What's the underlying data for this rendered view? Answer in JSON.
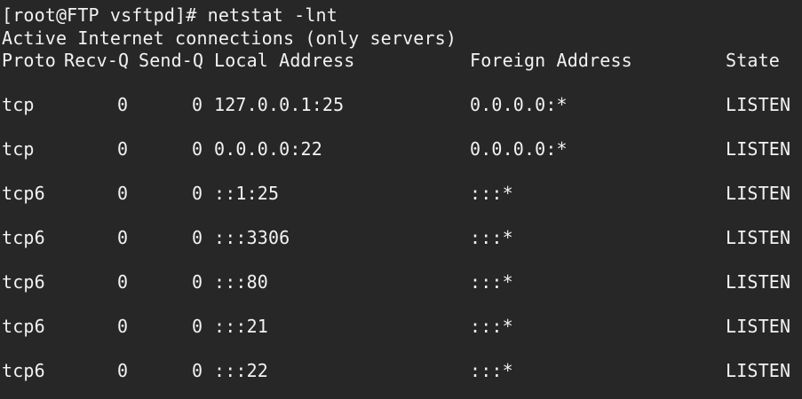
{
  "terminal": {
    "prompt_line": "[root@FTP vsftpd]# netstat -lnt",
    "status_line": "Active Internet connections (only servers)",
    "headers": {
      "proto": "Proto",
      "recvq": "Recv-Q",
      "sendq": "Send-Q",
      "local": "Local Address",
      "foreign": "Foreign Address",
      "state": "State"
    },
    "rows": [
      {
        "proto": "tcp",
        "recvq": "0",
        "sendq": "0",
        "local": "127.0.0.1:25",
        "foreign": "0.0.0.0:*",
        "state": "LISTEN"
      },
      {
        "proto": "tcp",
        "recvq": "0",
        "sendq": "0",
        "local": "0.0.0.0:22",
        "foreign": "0.0.0.0:*",
        "state": "LISTEN"
      },
      {
        "proto": "tcp6",
        "recvq": "0",
        "sendq": "0",
        "local": "::1:25",
        "foreign": ":::*",
        "state": "LISTEN"
      },
      {
        "proto": "tcp6",
        "recvq": "0",
        "sendq": "0",
        "local": ":::3306",
        "foreign": ":::*",
        "state": "LISTEN"
      },
      {
        "proto": "tcp6",
        "recvq": "0",
        "sendq": "0",
        "local": ":::80",
        "foreign": ":::*",
        "state": "LISTEN"
      },
      {
        "proto": "tcp6",
        "recvq": "0",
        "sendq": "0",
        "local": ":::21",
        "foreign": ":::*",
        "state": "LISTEN"
      },
      {
        "proto": "tcp6",
        "recvq": "0",
        "sendq": "0",
        "local": ":::22",
        "foreign": ":::*",
        "state": "LISTEN"
      }
    ]
  }
}
